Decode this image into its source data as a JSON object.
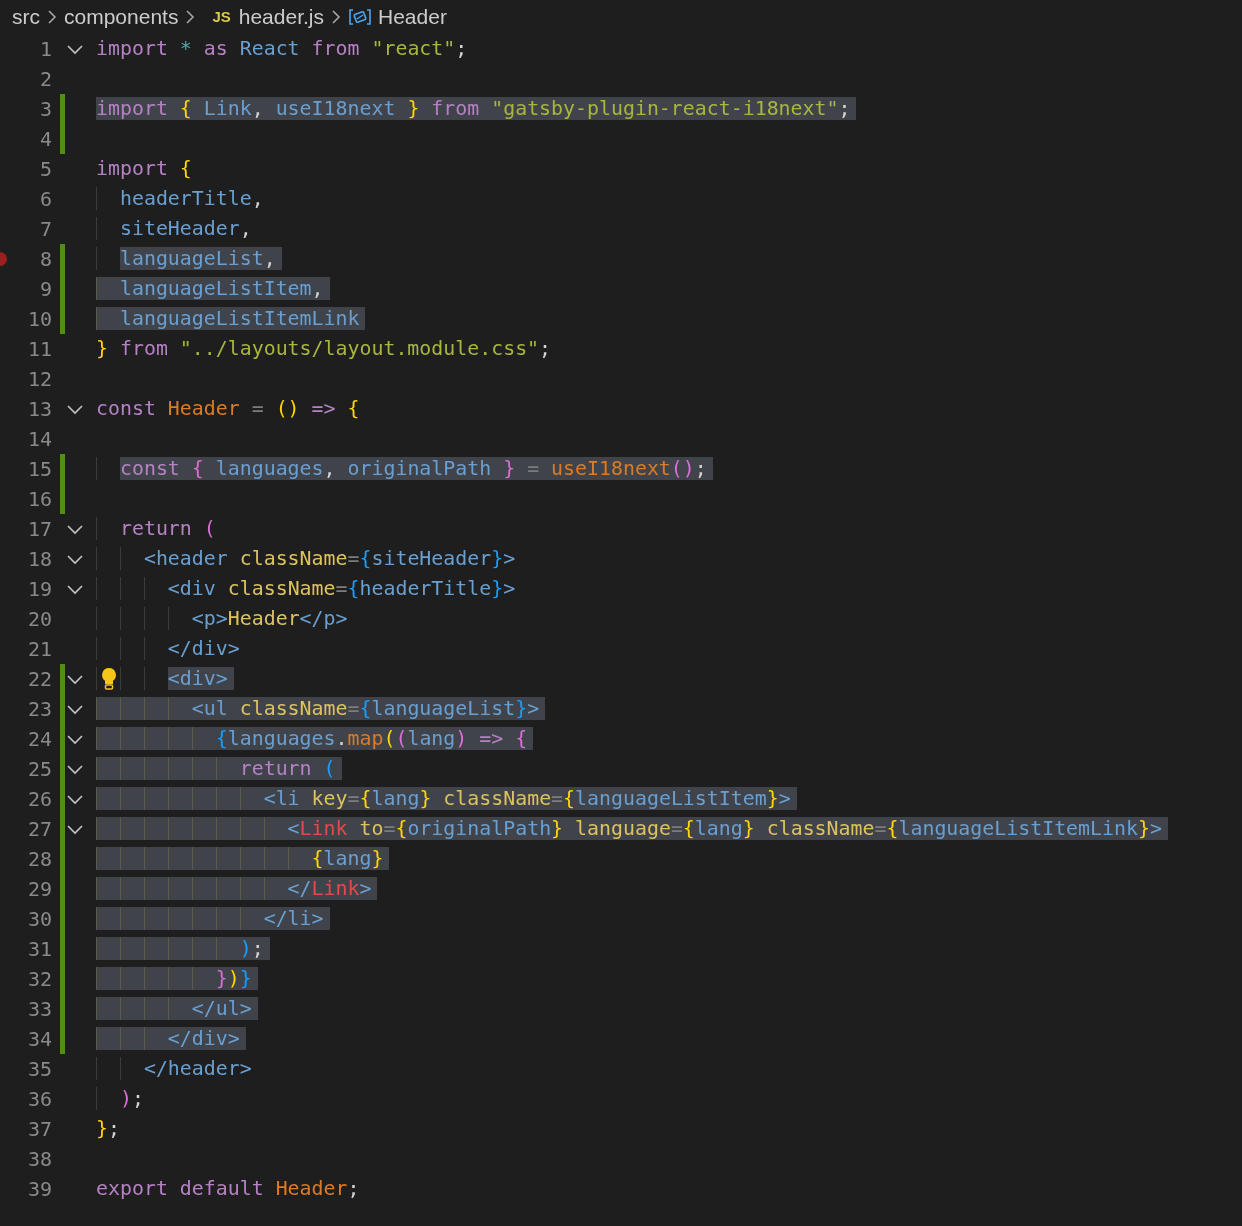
{
  "breadcrumb": [
    {
      "kind": "folder",
      "text": "src"
    },
    {
      "kind": "folder",
      "text": "components"
    },
    {
      "kind": "file",
      "badge": "JS",
      "text": "header.js"
    },
    {
      "kind": "symbol",
      "text": "Header"
    }
  ],
  "lines": [
    {
      "number": "1",
      "foldable": true,
      "changed": false,
      "selected": false,
      "breakpoint": false,
      "lightbulb": false,
      "tokens": [
        {
          "kind": "kw",
          "text": "import "
        },
        {
          "kind": "star",
          "text": "* "
        },
        {
          "kind": "kw",
          "text": "as "
        },
        {
          "kind": "id",
          "text": "React "
        },
        {
          "kind": "kw",
          "text": "from "
        },
        {
          "kind": "str",
          "text": "\"react\""
        },
        {
          "kind": "pun",
          "text": ";"
        }
      ]
    },
    {
      "number": "2",
      "foldable": false,
      "changed": false,
      "selected": false,
      "breakpoint": false,
      "lightbulb": false
    },
    {
      "number": "3",
      "foldable": false,
      "changed": true,
      "selected": true,
      "breakpoint": false,
      "lightbulb": false,
      "tokens": [
        {
          "kind": "kw",
          "text": "import "
        },
        {
          "kind": "b1",
          "text": "{ "
        },
        {
          "kind": "id",
          "text": "Link"
        },
        {
          "kind": "pun",
          "text": ", "
        },
        {
          "kind": "id",
          "text": "useI18next "
        },
        {
          "kind": "b1",
          "text": "} "
        },
        {
          "kind": "kw",
          "text": "from "
        },
        {
          "kind": "str",
          "text": "\"gatsby-plugin-react-i18next\""
        },
        {
          "kind": "pun",
          "text": ";"
        }
      ]
    },
    {
      "number": "4",
      "foldable": false,
      "changed": true,
      "selected": false,
      "breakpoint": false,
      "lightbulb": false
    },
    {
      "number": "5",
      "foldable": false,
      "changed": false,
      "selected": false,
      "breakpoint": false,
      "lightbulb": false,
      "tokens": [
        {
          "kind": "kw",
          "text": "import "
        },
        {
          "kind": "b1",
          "text": "{"
        }
      ]
    },
    {
      "number": "6",
      "foldable": false,
      "changed": false,
      "selected": false,
      "breakpoint": false,
      "lightbulb": false,
      "tokens": [
        {
          "kind": "id",
          "text": "  headerTitle"
        },
        {
          "kind": "pun",
          "text": ","
        }
      ]
    },
    {
      "number": "7",
      "foldable": false,
      "changed": false,
      "selected": false,
      "breakpoint": false,
      "lightbulb": false,
      "tokens": [
        {
          "kind": "id",
          "text": "  siteHeader"
        },
        {
          "kind": "pun",
          "text": ","
        }
      ]
    },
    {
      "number": "8",
      "foldable": false,
      "changed": true,
      "selected": true,
      "breakpoint": true,
      "lightbulb": false,
      "tokens": [
        {
          "kind": "id",
          "text": "  languageList"
        },
        {
          "kind": "pun",
          "text": ","
        }
      ]
    },
    {
      "number": "9",
      "foldable": false,
      "changed": true,
      "selected": true,
      "breakpoint": false,
      "lightbulb": false,
      "tokens": [
        {
          "kind": "id",
          "text": "  languageListItem"
        },
        {
          "kind": "pun",
          "text": ","
        }
      ]
    },
    {
      "number": "10",
      "foldable": false,
      "changed": true,
      "selected": true,
      "breakpoint": false,
      "lightbulb": false,
      "tokens": [
        {
          "kind": "id",
          "text": "  languageListItemLink"
        }
      ]
    },
    {
      "number": "11",
      "foldable": false,
      "changed": false,
      "selected": false,
      "breakpoint": false,
      "lightbulb": false,
      "tokens": [
        {
          "kind": "b1",
          "text": "} "
        },
        {
          "kind": "kw",
          "text": "from "
        },
        {
          "kind": "str",
          "text": "\"../layouts/layout.module.css\""
        },
        {
          "kind": "pun",
          "text": ";"
        }
      ]
    },
    {
      "number": "12",
      "foldable": false,
      "changed": false,
      "selected": false,
      "breakpoint": false,
      "lightbulb": false
    },
    {
      "number": "13",
      "foldable": true,
      "changed": false,
      "selected": false,
      "breakpoint": false,
      "lightbulb": false,
      "tokens": [
        {
          "kind": "kw",
          "text": "const "
        },
        {
          "kind": "fn",
          "text": "Header "
        },
        {
          "kind": "op",
          "text": "= "
        },
        {
          "kind": "b1",
          "text": "() "
        },
        {
          "kind": "kw",
          "text": "=> "
        },
        {
          "kind": "b1",
          "text": "{"
        }
      ]
    },
    {
      "number": "14",
      "foldable": false,
      "changed": false,
      "selected": false,
      "breakpoint": false,
      "lightbulb": false
    },
    {
      "number": "15",
      "foldable": false,
      "changed": true,
      "selected": true,
      "breakpoint": false,
      "lightbulb": false,
      "tokens": [
        {
          "kind": "kw",
          "text": "  const "
        },
        {
          "kind": "b2",
          "text": "{ "
        },
        {
          "kind": "id",
          "text": "languages"
        },
        {
          "kind": "pun",
          "text": ", "
        },
        {
          "kind": "id",
          "text": "originalPath "
        },
        {
          "kind": "b2",
          "text": "} "
        },
        {
          "kind": "op",
          "text": "= "
        },
        {
          "kind": "fn",
          "text": "useI18next"
        },
        {
          "kind": "b2",
          "text": "()"
        },
        {
          "kind": "pun",
          "text": ";"
        }
      ]
    },
    {
      "number": "16",
      "foldable": false,
      "changed": true,
      "selected": false,
      "breakpoint": false,
      "lightbulb": false
    },
    {
      "number": "17",
      "foldable": true,
      "changed": false,
      "selected": false,
      "breakpoint": false,
      "lightbulb": false,
      "tokens": [
        {
          "kind": "kw",
          "text": "  return "
        },
        {
          "kind": "b2",
          "text": "("
        }
      ]
    },
    {
      "number": "18",
      "foldable": true,
      "changed": false,
      "selected": false,
      "breakpoint": false,
      "lightbulb": false,
      "tokens": [
        {
          "kind": "tag",
          "text": "    <header "
        },
        {
          "kind": "attr",
          "text": "className"
        },
        {
          "kind": "op",
          "text": "="
        },
        {
          "kind": "b3",
          "text": "{"
        },
        {
          "kind": "id",
          "text": "siteHeader"
        },
        {
          "kind": "b3",
          "text": "}"
        },
        {
          "kind": "tag",
          "text": ">"
        }
      ]
    },
    {
      "number": "19",
      "foldable": true,
      "changed": false,
      "selected": false,
      "breakpoint": false,
      "lightbulb": false,
      "tokens": [
        {
          "kind": "tag",
          "text": "      <div "
        },
        {
          "kind": "attr",
          "text": "className"
        },
        {
          "kind": "op",
          "text": "="
        },
        {
          "kind": "b3",
          "text": "{"
        },
        {
          "kind": "id",
          "text": "headerTitle"
        },
        {
          "kind": "b3",
          "text": "}"
        },
        {
          "kind": "tag",
          "text": ">"
        }
      ]
    },
    {
      "number": "20",
      "foldable": false,
      "changed": false,
      "selected": false,
      "breakpoint": false,
      "lightbulb": false,
      "tokens": [
        {
          "kind": "tag",
          "text": "        <p>"
        },
        {
          "kind": "jsx",
          "text": "Header"
        },
        {
          "kind": "tag",
          "text": "</p>"
        }
      ]
    },
    {
      "number": "21",
      "foldable": false,
      "changed": false,
      "selected": false,
      "breakpoint": false,
      "lightbulb": false,
      "tokens": [
        {
          "kind": "tag",
          "text": "      </div>"
        }
      ]
    },
    {
      "number": "22",
      "foldable": true,
      "changed": true,
      "selected": true,
      "breakpoint": false,
      "lightbulb": true,
      "tokens": [
        {
          "kind": "tag",
          "text": "      <div>"
        }
      ]
    },
    {
      "number": "23",
      "foldable": true,
      "changed": true,
      "selected": true,
      "breakpoint": false,
      "lightbulb": false,
      "tokens": [
        {
          "kind": "tag",
          "text": "        <ul "
        },
        {
          "kind": "attr",
          "text": "className"
        },
        {
          "kind": "op",
          "text": "="
        },
        {
          "kind": "b3",
          "text": "{"
        },
        {
          "kind": "id",
          "text": "languageList"
        },
        {
          "kind": "b3",
          "text": "}"
        },
        {
          "kind": "tag",
          "text": ">"
        }
      ]
    },
    {
      "number": "24",
      "foldable": true,
      "changed": true,
      "selected": true,
      "breakpoint": false,
      "lightbulb": false,
      "tokens": [
        {
          "kind": "b3",
          "text": "          {"
        },
        {
          "kind": "id",
          "text": "languages"
        },
        {
          "kind": "pun",
          "text": "."
        },
        {
          "kind": "fn",
          "text": "map"
        },
        {
          "kind": "b1",
          "text": "("
        },
        {
          "kind": "b2",
          "text": "("
        },
        {
          "kind": "id",
          "text": "lang"
        },
        {
          "kind": "b2",
          "text": ") "
        },
        {
          "kind": "kw",
          "text": "=> "
        },
        {
          "kind": "b2",
          "text": "{"
        }
      ]
    },
    {
      "number": "25",
      "foldable": true,
      "changed": true,
      "selected": true,
      "breakpoint": false,
      "lightbulb": false,
      "tokens": [
        {
          "kind": "kw",
          "text": "            return "
        },
        {
          "kind": "b3",
          "text": "("
        }
      ]
    },
    {
      "number": "26",
      "foldable": true,
      "changed": true,
      "selected": true,
      "breakpoint": false,
      "lightbulb": false,
      "tokens": [
        {
          "kind": "tag",
          "text": "              <li "
        },
        {
          "kind": "attr",
          "text": "key"
        },
        {
          "kind": "op",
          "text": "="
        },
        {
          "kind": "b1",
          "text": "{"
        },
        {
          "kind": "id",
          "text": "lang"
        },
        {
          "kind": "b1",
          "text": "} "
        },
        {
          "kind": "attr",
          "text": "className"
        },
        {
          "kind": "op",
          "text": "="
        },
        {
          "kind": "b1",
          "text": "{"
        },
        {
          "kind": "id",
          "text": "languageListItem"
        },
        {
          "kind": "b1",
          "text": "}"
        },
        {
          "kind": "tag",
          "text": ">"
        }
      ]
    },
    {
      "number": "27",
      "foldable": true,
      "changed": true,
      "selected": true,
      "breakpoint": false,
      "lightbulb": false,
      "tokens": [
        {
          "kind": "tag",
          "text": "                <"
        },
        {
          "kind": "comp",
          "text": "Link "
        },
        {
          "kind": "attr",
          "text": "to"
        },
        {
          "kind": "op",
          "text": "="
        },
        {
          "kind": "b1",
          "text": "{"
        },
        {
          "kind": "id",
          "text": "originalPath"
        },
        {
          "kind": "b1",
          "text": "} "
        },
        {
          "kind": "attr",
          "text": "language"
        },
        {
          "kind": "op",
          "text": "="
        },
        {
          "kind": "b1",
          "text": "{"
        },
        {
          "kind": "id",
          "text": "lang"
        },
        {
          "kind": "b1",
          "text": "} "
        },
        {
          "kind": "attr",
          "text": "className"
        },
        {
          "kind": "op",
          "text": "="
        },
        {
          "kind": "b1",
          "text": "{"
        },
        {
          "kind": "id",
          "text": "languageListItemLink"
        },
        {
          "kind": "b1",
          "text": "}"
        },
        {
          "kind": "tag",
          "text": ">"
        }
      ]
    },
    {
      "number": "28",
      "foldable": false,
      "changed": true,
      "selected": true,
      "breakpoint": false,
      "lightbulb": false,
      "tokens": [
        {
          "kind": "b1",
          "text": "                  {"
        },
        {
          "kind": "id",
          "text": "lang"
        },
        {
          "kind": "b1",
          "text": "}"
        }
      ]
    },
    {
      "number": "29",
      "foldable": false,
      "changed": true,
      "selected": true,
      "breakpoint": false,
      "lightbulb": false,
      "tokens": [
        {
          "kind": "tag",
          "text": "                </"
        },
        {
          "kind": "comp",
          "text": "Link"
        },
        {
          "kind": "tag",
          "text": ">"
        }
      ]
    },
    {
      "number": "30",
      "foldable": false,
      "changed": true,
      "selected": true,
      "breakpoint": false,
      "lightbulb": false,
      "tokens": [
        {
          "kind": "tag",
          "text": "              </li>"
        }
      ]
    },
    {
      "number": "31",
      "foldable": false,
      "changed": true,
      "selected": true,
      "breakpoint": false,
      "lightbulb": false,
      "tokens": [
        {
          "kind": "b3",
          "text": "            )"
        },
        {
          "kind": "pun",
          "text": ";"
        }
      ]
    },
    {
      "number": "32",
      "foldable": false,
      "changed": true,
      "selected": true,
      "breakpoint": false,
      "lightbulb": false,
      "tokens": [
        {
          "kind": "b2",
          "text": "          }"
        },
        {
          "kind": "b1",
          "text": ")"
        },
        {
          "kind": "b3",
          "text": "}"
        }
      ]
    },
    {
      "number": "33",
      "foldable": false,
      "changed": true,
      "selected": true,
      "breakpoint": false,
      "lightbulb": false,
      "tokens": [
        {
          "kind": "tag",
          "text": "        </ul>"
        }
      ]
    },
    {
      "number": "34",
      "foldable": false,
      "changed": true,
      "selected": true,
      "breakpoint": false,
      "lightbulb": false,
      "tokens": [
        {
          "kind": "tag",
          "text": "      </div>"
        }
      ]
    },
    {
      "number": "35",
      "foldable": false,
      "changed": false,
      "selected": false,
      "breakpoint": false,
      "lightbulb": false,
      "tokens": [
        {
          "kind": "tag",
          "text": "    </header>"
        }
      ]
    },
    {
      "number": "36",
      "foldable": false,
      "changed": false,
      "selected": false,
      "breakpoint": false,
      "lightbulb": false,
      "tokens": [
        {
          "kind": "b2",
          "text": "  )"
        },
        {
          "kind": "pun",
          "text": ";"
        }
      ]
    },
    {
      "number": "37",
      "foldable": false,
      "changed": false,
      "selected": false,
      "breakpoint": false,
      "lightbulb": false,
      "tokens": [
        {
          "kind": "b1",
          "text": "}"
        },
        {
          "kind": "pun",
          "text": ";"
        }
      ]
    },
    {
      "number": "38",
      "foldable": false,
      "changed": false,
      "selected": false,
      "breakpoint": false,
      "lightbulb": false
    },
    {
      "number": "39",
      "foldable": false,
      "changed": false,
      "selected": false,
      "breakpoint": false,
      "lightbulb": false,
      "tokens": [
        {
          "kind": "kw",
          "text": "export default "
        },
        {
          "kind": "fn",
          "text": "Header"
        },
        {
          "kind": "pun",
          "text": ";"
        }
      ]
    }
  ]
}
